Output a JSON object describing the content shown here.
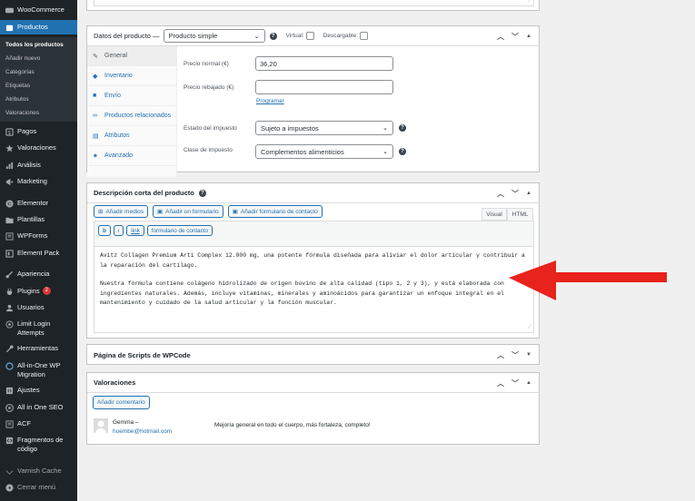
{
  "sidebar": {
    "top_item": "WooCommerce",
    "products": "Productos",
    "submenu": [
      "Todos los productos",
      "Añadir nuevo",
      "Categorías",
      "Etiquetas",
      "Atributos",
      "Valoraciones"
    ],
    "items": [
      {
        "label": "Pagos",
        "icon": "payments-icon"
      },
      {
        "label": "Valoraciones",
        "icon": "star-icon"
      },
      {
        "label": "Análisis",
        "icon": "chart-icon"
      },
      {
        "label": "Marketing",
        "icon": "megaphone-icon"
      },
      {
        "label": "Elementor",
        "icon": "elementor-icon"
      },
      {
        "label": "Plantillas",
        "icon": "folder-icon"
      },
      {
        "label": "WPForms",
        "icon": "forms-icon"
      },
      {
        "label": "Element Pack",
        "icon": "pack-icon"
      },
      {
        "label": "Apariencia",
        "icon": "brush-icon"
      },
      {
        "label": "Plugins",
        "icon": "plugin-icon",
        "badge": "2"
      },
      {
        "label": "Usuarios",
        "icon": "user-icon"
      },
      {
        "label": "Limit Login Attempts",
        "icon": "lock-icon"
      },
      {
        "label": "Herramientas",
        "icon": "wrench-icon"
      },
      {
        "label": "All-in-One WP Migration",
        "icon": "migration-icon"
      },
      {
        "label": "Ajustes",
        "icon": "settings-icon"
      },
      {
        "label": "All in One SEO",
        "icon": "seo-icon"
      },
      {
        "label": "ACF",
        "icon": "acf-icon"
      },
      {
        "label": "Fragmentos de código",
        "icon": "code-icon"
      },
      {
        "label": "Varnish Cache",
        "icon": "cache-icon"
      },
      {
        "label": "Cerrar menú",
        "icon": "collapse-icon"
      }
    ]
  },
  "product_data": {
    "title": "Datos del producto —",
    "type_select": "Producto simple",
    "virtual_label": "Virtual:",
    "downloadable_label": "Descargable:",
    "tabs": [
      "General",
      "Inventario",
      "Envío",
      "Productos relacionados",
      "Atributos",
      "Avanzado"
    ],
    "regular_price_label": "Precio normal (€)",
    "regular_price_value": "36,20",
    "sale_price_label": "Precio rebajado (€)",
    "sale_price_value": "",
    "schedule_link": "Programar",
    "tax_status_label": "Estado del impuesto",
    "tax_status_value": "Sujeto a impuestos",
    "tax_class_label": "Clase de impuesto",
    "tax_class_value": "Complementos alimenticios"
  },
  "short_description": {
    "title": "Descripción corta del producto",
    "add_media": "Añadir medios",
    "add_form": "Añadir un formulario",
    "add_contact_form": "Añadir formulario de contacto",
    "tab_visual": "Visual",
    "tab_html": "HTML",
    "qt_bold": "b",
    "qt_italic": "i",
    "qt_link": "link",
    "qt_contact": "formulario de contacto",
    "paragraph1": "Avitz Collagen Premium Arti Complex 12.000 mg, una potente fórmula diseñada para aliviar el dolor articular y contribuir a la reparación del cartílago.",
    "paragraph2": "Nuestra fórmula contiene colágeno hidrolizado de origen bovino de alta calidad (tipo 1, 2 y 3), y está elaborada con ingredientes naturales. Además, incluye vitaminas, minerales y aminoácidos para garantizar un enfoque integral en el mantenimiento y cuidado de la salud articular y la función muscular."
  },
  "scripts_panel": {
    "title": "Página de Scripts de WPCode"
  },
  "reviews": {
    "title": "Valoraciones",
    "add_comment": "Añadir comentario",
    "author": "Gemma –",
    "email": "huembe@hotmail.com",
    "text": "Mejoría general en todo el cuerpo, más fortaleza, completo!"
  },
  "colors": {
    "accent": "#2271b1",
    "sidebar": "#1d2327",
    "arrow": "#e8221c"
  }
}
